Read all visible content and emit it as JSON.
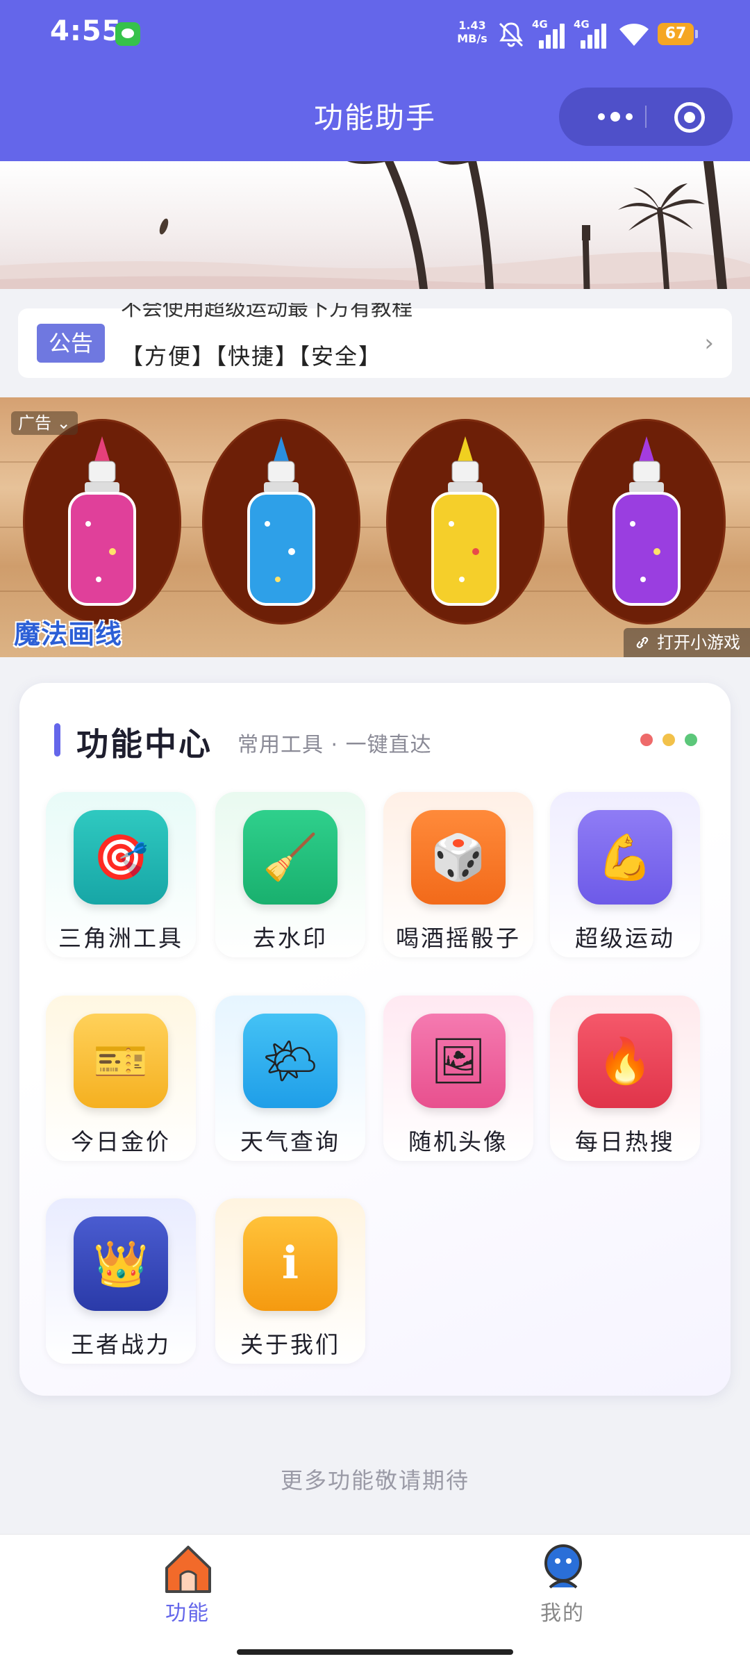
{
  "status_bar": {
    "time": "4:55",
    "net_speed_value": "1.43",
    "net_speed_unit": "MB/s",
    "sim1": "4G",
    "sim2": "4G",
    "battery": "67"
  },
  "nav": {
    "title": "功能助手"
  },
  "notice": {
    "tag": "公告",
    "line1": "不会使用超级运动最下方有教程",
    "line2": "【方便】【快捷】【安全】"
  },
  "ad": {
    "tag": "广告",
    "brand": "魔法画线",
    "open_label": "打开小游戏"
  },
  "function_center": {
    "title": "功能中心",
    "subtitle": "常用工具 · 一键直达",
    "items": [
      {
        "label": "三角洲工具",
        "icon": "🎯"
      },
      {
        "label": "去水印",
        "icon": "🧹"
      },
      {
        "label": "喝酒摇骰子",
        "icon": "🎲"
      },
      {
        "label": "超级运动",
        "icon": "💪"
      },
      {
        "label": "今日金价",
        "icon": "🎫"
      },
      {
        "label": "天气查询",
        "icon": "🌤"
      },
      {
        "label": "随机头像",
        "icon": "🖼"
      },
      {
        "label": "每日热搜",
        "icon": "🔥"
      },
      {
        "label": "王者战力",
        "icon": "👑"
      },
      {
        "label": "关于我们",
        "icon": "ℹ"
      }
    ]
  },
  "footer_text": "更多功能敬请期待",
  "tabbar": {
    "tabs": [
      {
        "label": "功能"
      },
      {
        "label": "我的"
      }
    ]
  },
  "colors": {
    "primary": "#6466ea",
    "active_tab": "#6466ea",
    "inactive_tab": "#888888"
  }
}
